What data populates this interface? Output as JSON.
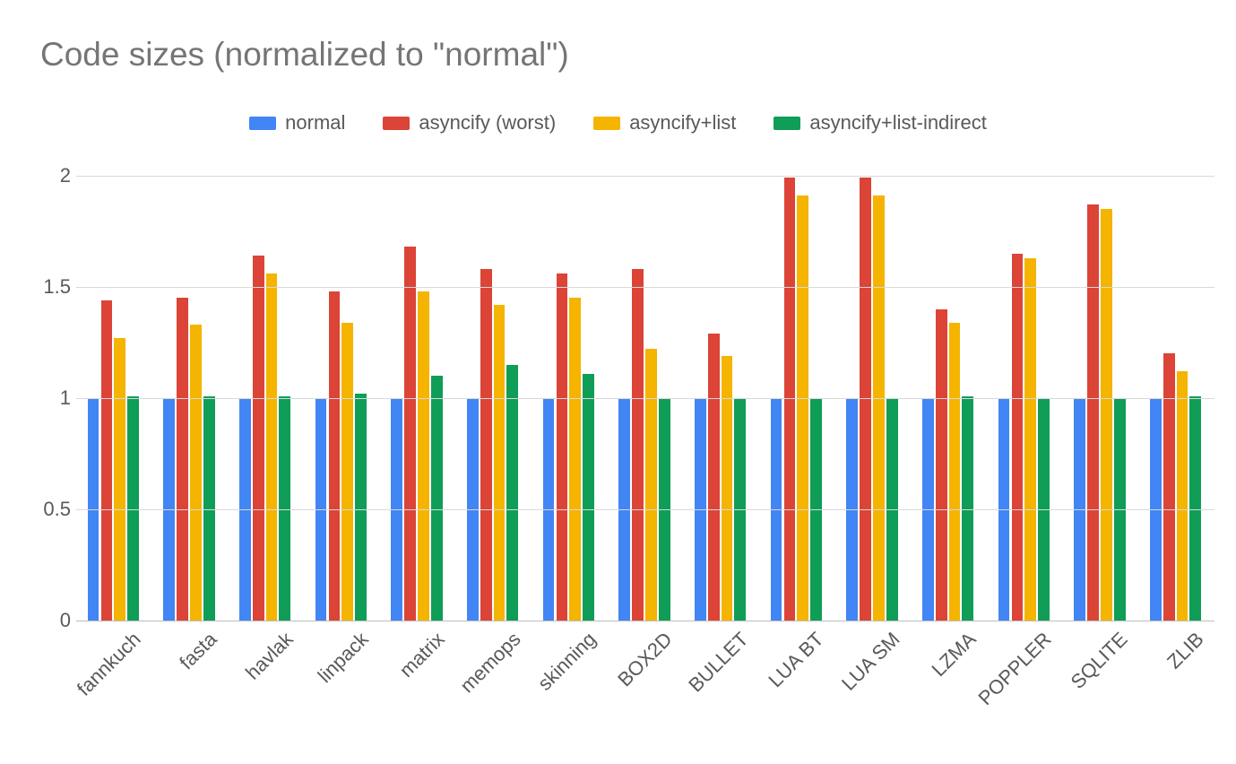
{
  "chart_data": {
    "type": "bar",
    "title": "Code sizes (normalized to \"normal\")",
    "xlabel": "",
    "ylabel": "",
    "ylim": [
      0,
      2
    ],
    "yticks": [
      0,
      0.5,
      1,
      1.5,
      2
    ],
    "colors": {
      "normal": "#4285F4",
      "asyncify_worst": "#DB4437",
      "asyncify_list": "#F4B400",
      "asyncify_list_indirect": "#0F9D58"
    },
    "categories": [
      "fannkuch",
      "fasta",
      "havlak",
      "linpack",
      "matrix",
      "memops",
      "skinning",
      "BOX2D",
      "BULLET",
      "LUA BT",
      "LUA SM",
      "LZMA",
      "POPPLER",
      "SQLITE",
      "ZLIB"
    ],
    "series": [
      {
        "name": "normal",
        "legend_label": "normal",
        "color_key": "normal",
        "values": [
          1.0,
          1.0,
          1.0,
          1.0,
          1.0,
          1.0,
          1.0,
          1.0,
          1.0,
          1.0,
          1.0,
          1.0,
          1.0,
          1.0,
          1.0
        ]
      },
      {
        "name": "asyncify (worst)",
        "legend_label": "asyncify (worst)",
        "color_key": "asyncify_worst",
        "values": [
          1.44,
          1.45,
          1.64,
          1.48,
          1.68,
          1.58,
          1.56,
          1.58,
          1.29,
          1.99,
          1.99,
          1.4,
          1.65,
          1.87,
          1.2
        ]
      },
      {
        "name": "asyncify+list",
        "legend_label": "asyncify+list",
        "color_key": "asyncify_list",
        "values": [
          1.27,
          1.33,
          1.56,
          1.34,
          1.48,
          1.42,
          1.45,
          1.22,
          1.19,
          1.91,
          1.91,
          1.34,
          1.63,
          1.85,
          1.12
        ]
      },
      {
        "name": "asyncify+list-indirect",
        "legend_label": "asyncify+list-indirect",
        "color_key": "asyncify_list_indirect",
        "values": [
          1.01,
          1.01,
          1.01,
          1.02,
          1.1,
          1.15,
          1.11,
          1.0,
          1.0,
          1.0,
          1.0,
          1.01,
          1.0,
          1.0,
          1.01
        ]
      }
    ]
  }
}
